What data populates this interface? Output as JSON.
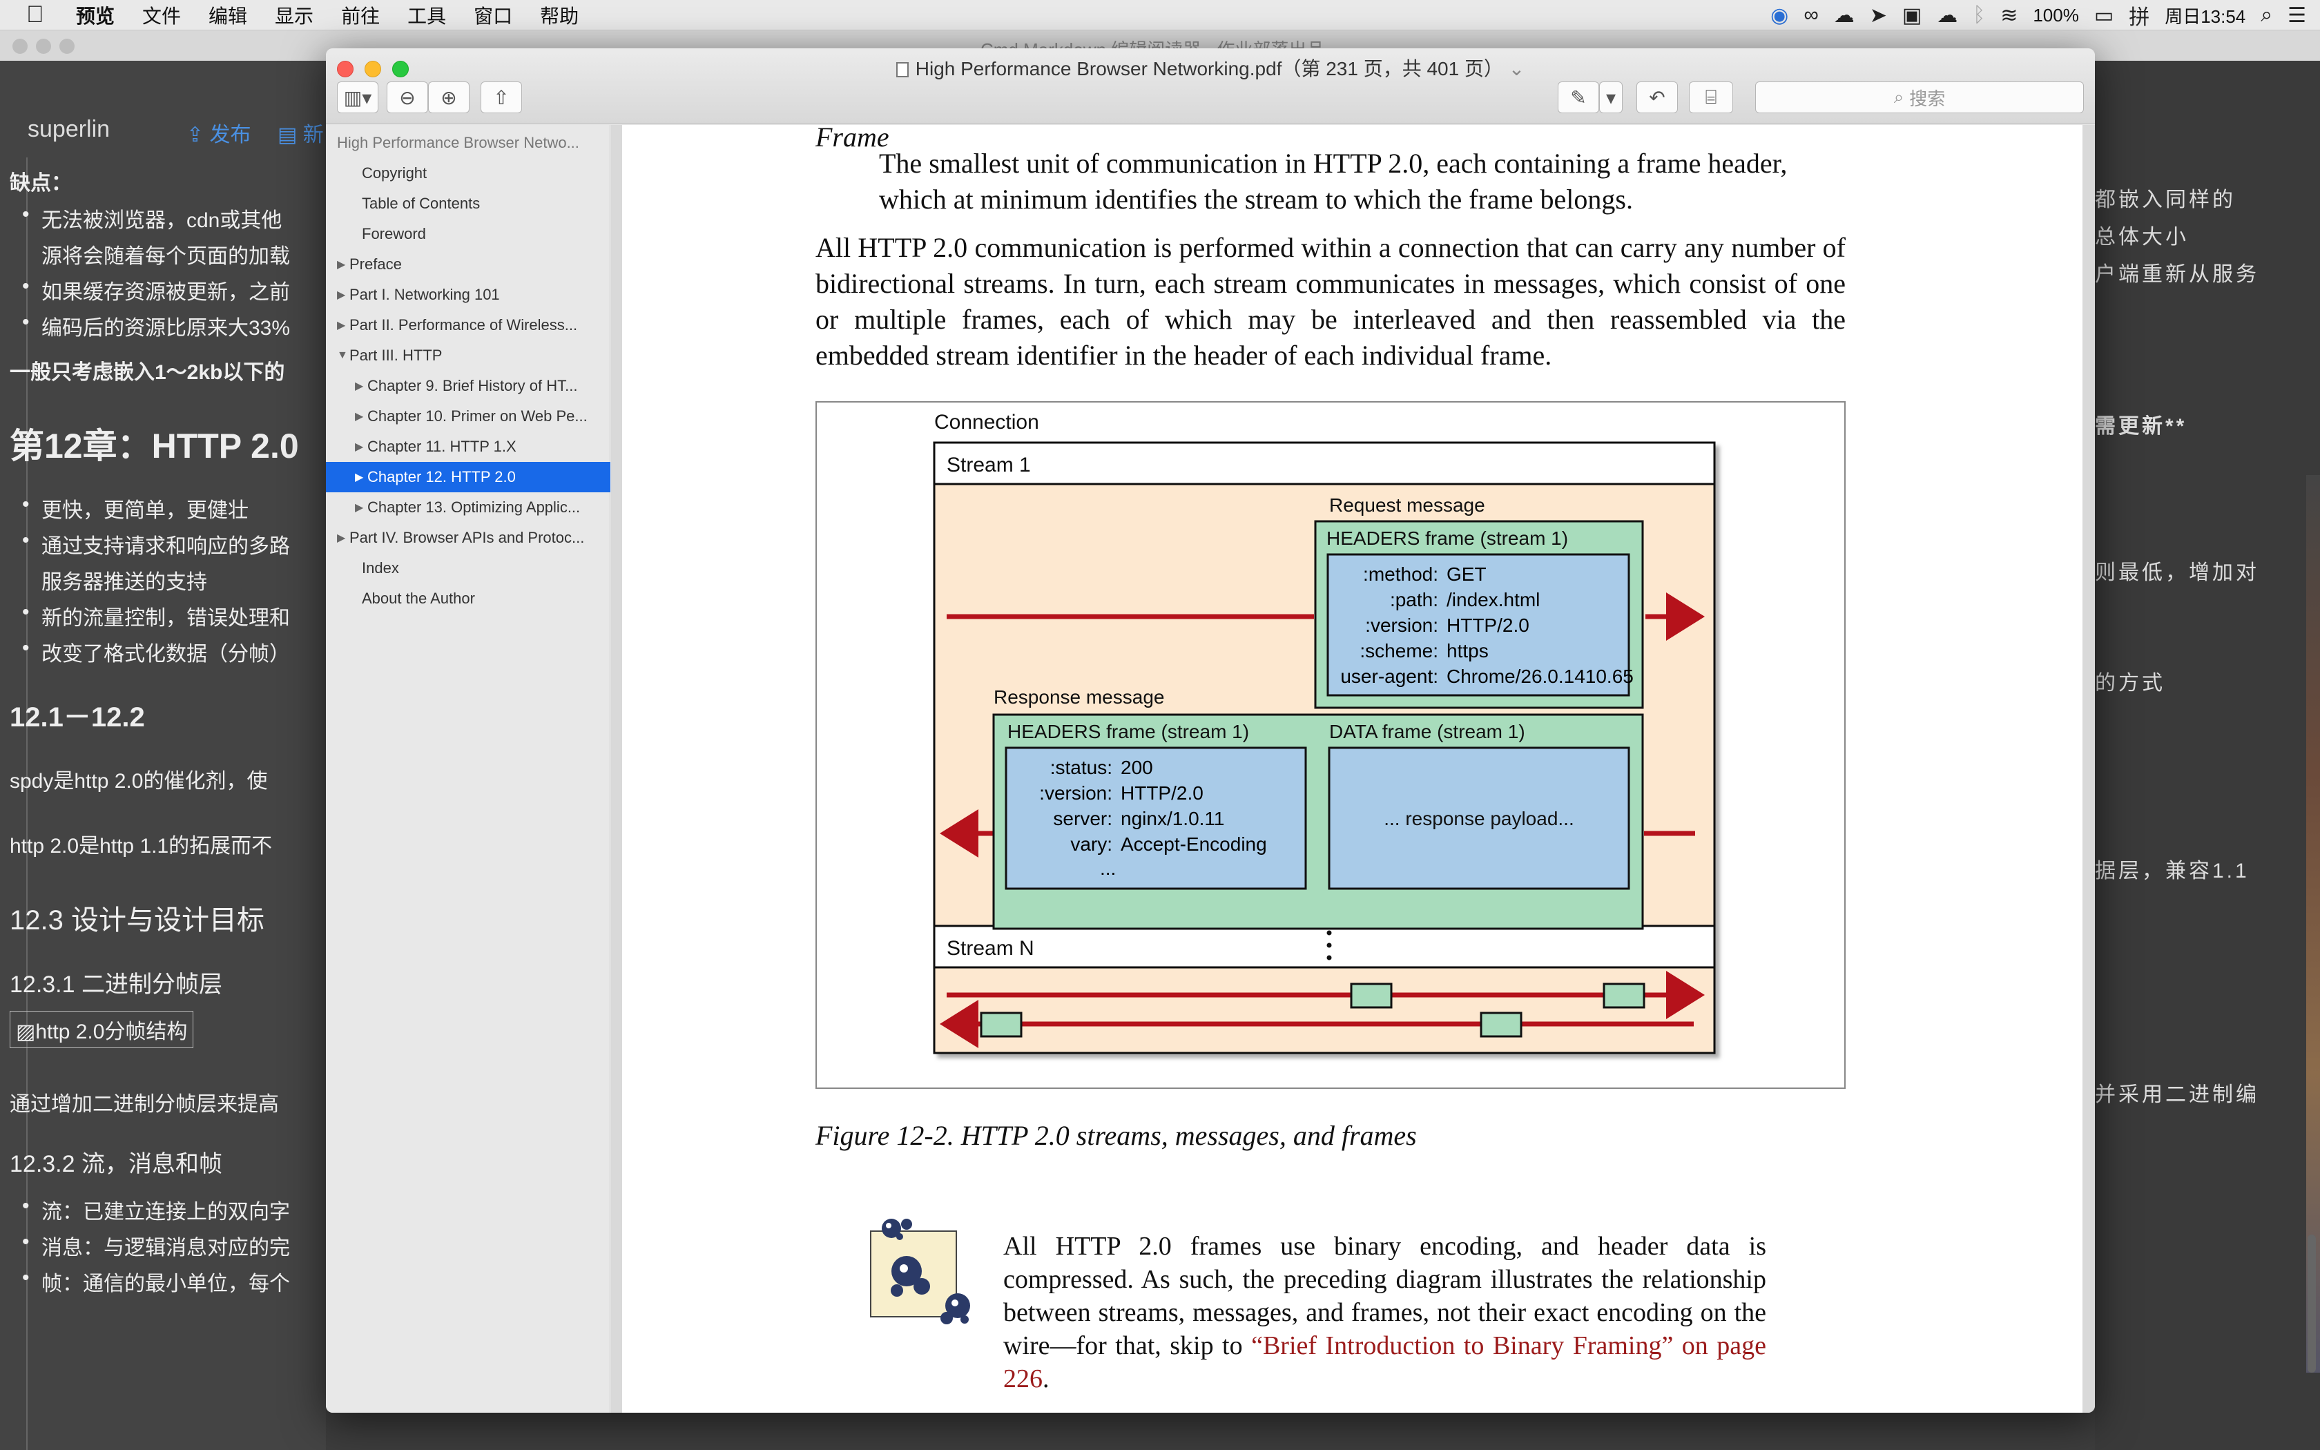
{
  "menubar": {
    "apple": "",
    "items": [
      "预览",
      "文件",
      "编辑",
      "显示",
      "前往",
      "工具",
      "窗口",
      "帮助"
    ],
    "battery": "100%",
    "datetime": "周日13:54"
  },
  "background_app": {
    "title": "Cmd Markdown 编辑阅读器 - 作业部落出品",
    "brand": "superlin",
    "publish_label": "发布",
    "new_label": "新",
    "left_lines": [
      "缺点：",
      "无法被浏览器，cdn或其他",
      "源将会随着每个页面的加载",
      "如果缓存资源被更新，之前",
      "编码后的资源比原来大33%",
      "一般只考虑嵌入1～2kb以下的",
      "第12章：HTTP 2.0",
      "更快，更简单，更健壮",
      "通过支持请求和响应的多路",
      "服务器推送的支持",
      "新的流量控制，错误处理和",
      "改变了格式化数据（分帧）",
      "12.1－12.2",
      "spdy是http 2.0的催化剂，使",
      "http 2.0是http 1.1的拓展而不",
      "12.3 设计与设计目标",
      "12.3.1 二进制分帧层",
      "http 2.0分帧结构",
      "通过增加二进制分帧层来提高",
      "12.3.2 流，消息和帧",
      "流：已建立连接上的双向字",
      "消息：与逻辑消息对应的完",
      "帧：通信的最小单位，每个"
    ],
    "right_lines": [
      "都嵌入同样的",
      "总体大小",
      "户端重新从服务",
      "需更新**",
      "则最低，增加对",
      "的方式",
      "据层，兼容1.1",
      "并采用二进制编"
    ]
  },
  "preview": {
    "title": "High Performance Browser Networking.pdf（第 231 页，共 401 页）",
    "title_chevron": "⌄",
    "search_placeholder": "搜索",
    "toc": [
      {
        "label": "High Performance Browser Netwo...",
        "arrow": "",
        "level": 0
      },
      {
        "label": "Copyright",
        "arrow": "",
        "level": 1
      },
      {
        "label": "Table of Contents",
        "arrow": "",
        "level": 1
      },
      {
        "label": "Foreword",
        "arrow": "",
        "level": 1
      },
      {
        "label": "Preface",
        "arrow": "▶",
        "level": 1
      },
      {
        "label": "Part I. Networking 101",
        "arrow": "▶",
        "level": 1
      },
      {
        "label": "Part II. Performance of Wireless...",
        "arrow": "▶",
        "level": 1
      },
      {
        "label": "Part III. HTTP",
        "arrow": "▼",
        "level": 1
      },
      {
        "label": "Chapter 9. Brief History of HT...",
        "arrow": "▶",
        "level": 2
      },
      {
        "label": "Chapter 10. Primer on Web Pe...",
        "arrow": "▶",
        "level": 2
      },
      {
        "label": "Chapter 11. HTTP 1.X",
        "arrow": "▶",
        "level": 2
      },
      {
        "label": "Chapter 12. HTTP 2.0",
        "arrow": "▶",
        "level": 2,
        "selected": true
      },
      {
        "label": "Chapter 13. Optimizing Applic...",
        "arrow": "▶",
        "level": 2
      },
      {
        "label": "Part IV. Browser APIs and Protoc...",
        "arrow": "▶",
        "level": 1
      },
      {
        "label": "Index",
        "arrow": "",
        "level": 1
      },
      {
        "label": "About the Author",
        "arrow": "",
        "level": 1
      }
    ]
  },
  "page": {
    "frame_term": "Frame",
    "frame_def": "The smallest unit of communication in HTTP 2.0, each containing a frame header, which at minimum identifies the stream to which the frame belongs.",
    "paragraph": "All HTTP 2.0 communication is performed within a connection that can carry any number of bidirectional streams. In turn, each stream communicates in messages, which consist of one or multiple frames, each of which may be interleaved and then reassembled via the embedded stream identifier in the header of each individual frame.",
    "caption": "Figure 12-2. HTTP 2.0 streams, messages, and frames",
    "note_text": "All HTTP 2.0 frames use binary encoding, and header data is compressed. As such, the preceding diagram illustrates the relationship between streams, messages, and frames, not their exact encoding on the wire—for that, skip to ",
    "note_link": "“Brief Introduction to Binary Framing” on page 226",
    "note_end": "."
  },
  "diagram": {
    "connection": "Connection",
    "stream1": "Stream 1",
    "request_message": "Request message",
    "request_frame": "HEADERS frame (stream 1)",
    "request_headers": [
      {
        "k": ":method:",
        "v": "GET"
      },
      {
        "k": ":path:",
        "v": "/index.html"
      },
      {
        "k": ":version:",
        "v": "HTTP/2.0"
      },
      {
        "k": ":scheme:",
        "v": "https"
      },
      {
        "k": "user-agent:",
        "v": "Chrome/26.0.1410.65"
      }
    ],
    "response_message": "Response message",
    "response_frame": "HEADERS frame (stream 1)",
    "data_frame": "DATA frame (stream 1)",
    "response_headers": [
      {
        "k": ":status:",
        "v": "200"
      },
      {
        "k": ":version:",
        "v": "HTTP/2.0"
      },
      {
        "k": "server:",
        "v": "nginx/1.0.11"
      },
      {
        "k": "vary:",
        "v": "Accept-Encoding"
      }
    ],
    "response_ellipsis": "...",
    "payload": "... response payload...",
    "streamN": "Stream N",
    "colors": {
      "stream_bg": "#fde8d0",
      "frame_green": "#a8dcbc",
      "header_blue": "#a9cbe8",
      "arrow_red": "#b5121b"
    }
  }
}
